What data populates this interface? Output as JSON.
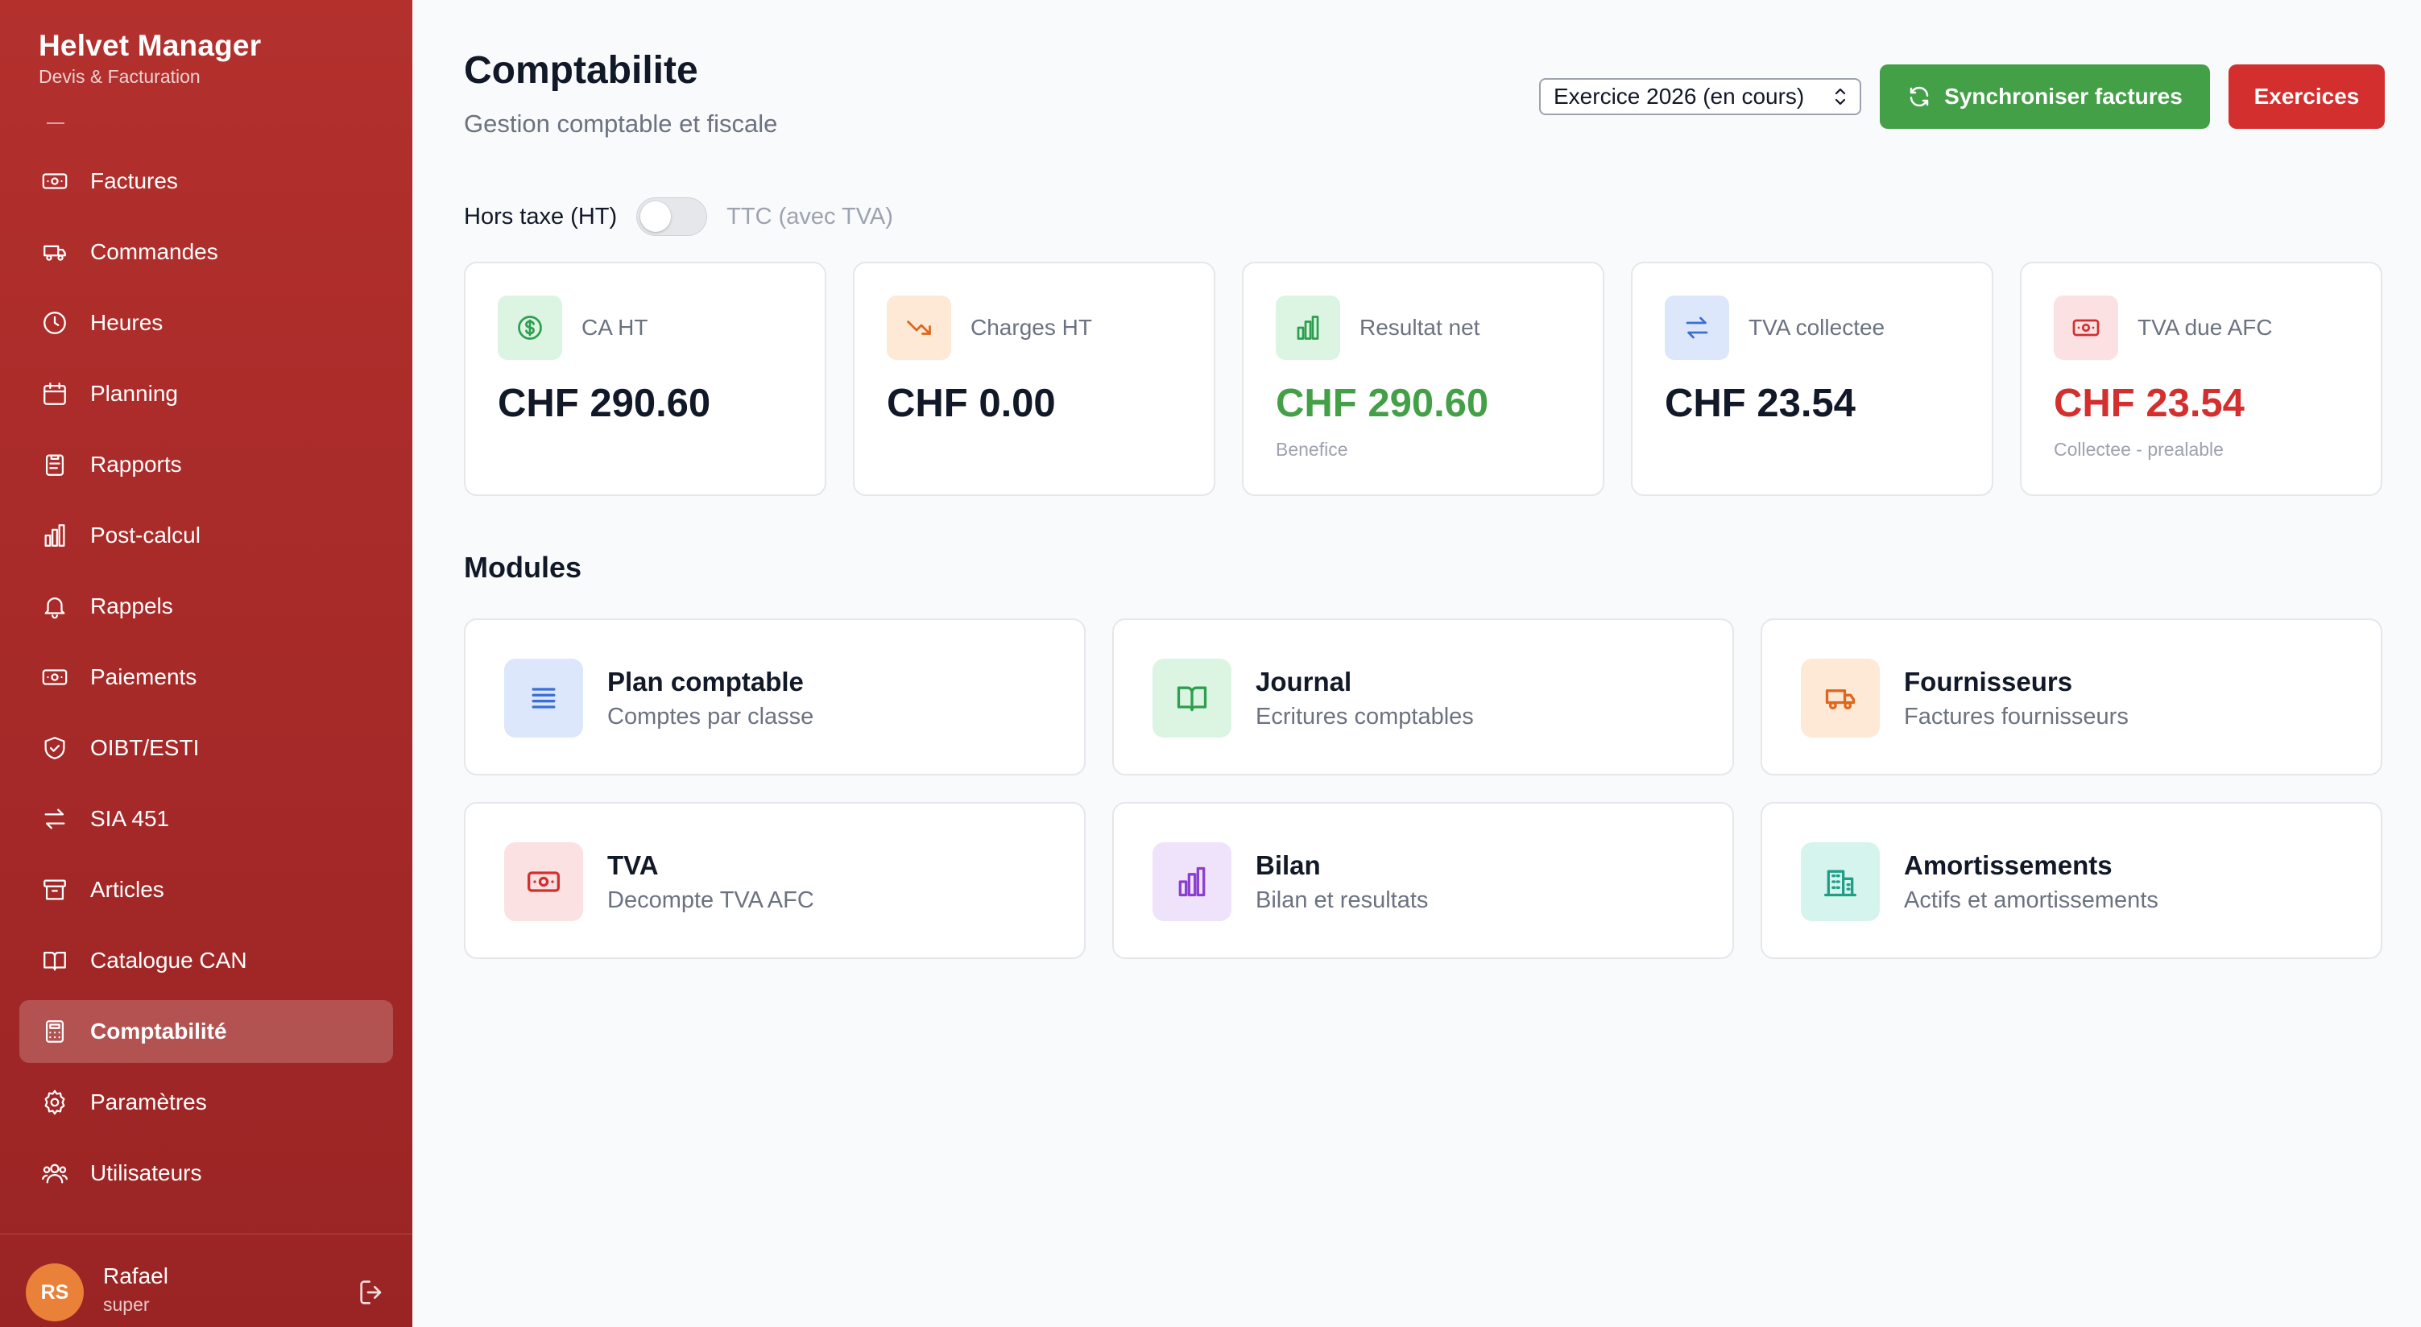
{
  "brand": {
    "title": "Helvet Manager",
    "subtitle": "Devis & Facturation"
  },
  "sidebar": {
    "items": [
      {
        "label": "Factures",
        "icon": "banknote-icon"
      },
      {
        "label": "Commandes",
        "icon": "truck-icon"
      },
      {
        "label": "Heures",
        "icon": "clock-icon"
      },
      {
        "label": "Planning",
        "icon": "calendar-icon"
      },
      {
        "label": "Rapports",
        "icon": "clipboard-icon"
      },
      {
        "label": "Post-calcul",
        "icon": "bar-chart-icon"
      },
      {
        "label": "Rappels",
        "icon": "bell-icon"
      },
      {
        "label": "Paiements",
        "icon": "banknote-icon"
      },
      {
        "label": "OIBT/ESTI",
        "icon": "shield-check-icon"
      },
      {
        "label": "SIA 451",
        "icon": "arrows-exchange-icon"
      },
      {
        "label": "Articles",
        "icon": "archive-icon"
      },
      {
        "label": "Catalogue CAN",
        "icon": "book-open-icon"
      },
      {
        "label": "Comptabilité",
        "icon": "calculator-icon",
        "active": true
      },
      {
        "label": "Paramètres",
        "icon": "gear-icon"
      },
      {
        "label": "Utilisateurs",
        "icon": "users-icon"
      }
    ]
  },
  "user": {
    "initials": "RS",
    "name": "Rafael",
    "role": "super",
    "avatar_color": "#e98138"
  },
  "header": {
    "title": "Comptabilite",
    "subtitle": "Gestion comptable et fiscale",
    "year_select": "Exercice 2026 (en cours)",
    "sync_label": "Synchroniser factures",
    "exercices_label": "Exercices"
  },
  "toggle": {
    "left_label": "Hors taxe (HT)",
    "right_label": "TTC (avec TVA)",
    "checked": false
  },
  "kpis": [
    {
      "label": "CA HT",
      "value": "CHF 290.60",
      "note": "",
      "icon": "dollar-circle-icon",
      "value_color": "#111827"
    },
    {
      "label": "Charges HT",
      "value": "CHF 0.00",
      "note": "",
      "icon": "trending-down-icon",
      "value_color": "#111827"
    },
    {
      "label": "Resultat net",
      "value": "CHF 290.60",
      "note": "Benefice",
      "icon": "bar-chart-icon",
      "value_color": "#43a047"
    },
    {
      "label": "TVA collectee",
      "value": "CHF 23.54",
      "note": "",
      "icon": "arrows-exchange-icon",
      "value_color": "#111827"
    },
    {
      "label": "TVA due AFC",
      "value": "CHF 23.54",
      "note": "Collectee - prealable",
      "icon": "banknote-icon",
      "value_color": "#d32f2f"
    }
  ],
  "modules_title": "Modules",
  "modules": [
    {
      "title": "Plan comptable",
      "subtitle": "Comptes par classe",
      "icon": "list-icon"
    },
    {
      "title": "Journal",
      "subtitle": "Ecritures comptables",
      "icon": "book-open-icon"
    },
    {
      "title": "Fournisseurs",
      "subtitle": "Factures fournisseurs",
      "icon": "truck-icon"
    },
    {
      "title": "TVA",
      "subtitle": "Decompte TVA AFC",
      "icon": "banknote-icon"
    },
    {
      "title": "Bilan",
      "subtitle": "Bilan et resultats",
      "icon": "bar-chart-icon"
    },
    {
      "title": "Amortissements",
      "subtitle": "Actifs et amortissements",
      "icon": "building-icon"
    }
  ]
}
